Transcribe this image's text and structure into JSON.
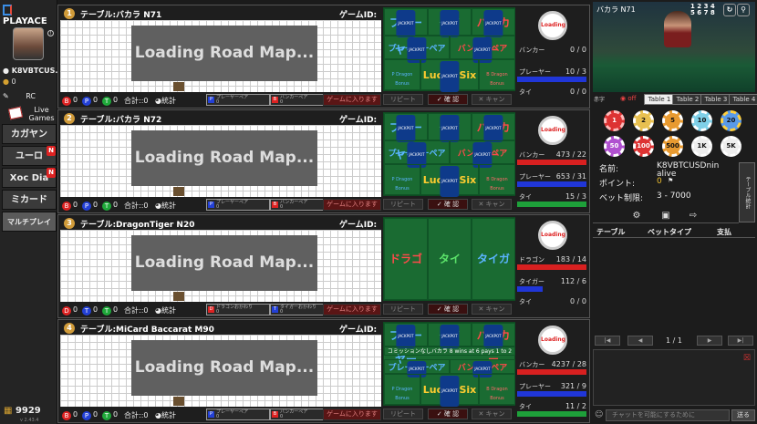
{
  "app": {
    "logo": "PLAYACE",
    "version": "v 2.43.4"
  },
  "user": {
    "name": "K8VBTCUS...",
    "balance": "0",
    "total": "9929"
  },
  "sidebar": {
    "rc": "RC",
    "live_games": "Live Games",
    "items": [
      {
        "label": "カガヤン",
        "badge": ""
      },
      {
        "label": "ユーロ",
        "badge": "N"
      },
      {
        "label": "Xoc Dia",
        "badge": "N"
      },
      {
        "label": "ミカード",
        "badge": ""
      },
      {
        "label": "マルチプレイ",
        "badge": "",
        "active": true
      }
    ]
  },
  "common": {
    "game_id": "ゲームID:",
    "loading": "Loading Road Map...",
    "total": "合計::0",
    "stats": "統計",
    "enter": "ゲームに入ります",
    "repeat": "リピート",
    "confirm": "確 認",
    "cancel": "キャン",
    "loading_btn": "Loading",
    "jackpot": "JACKPOT"
  },
  "tables": [
    {
      "num": "1",
      "name": "テーブル:バカラ N71",
      "type": "baccarat",
      "counters": [
        {
          "k": "B",
          "c": "dr",
          "v": "0"
        },
        {
          "k": "P",
          "c": "db",
          "v": "0"
        },
        {
          "k": "T",
          "c": "dg",
          "v": "0"
        }
      ],
      "mini": [
        {
          "k": "P",
          "c": "db",
          "t": "プレーヤーペア\n0"
        },
        {
          "k": "B",
          "c": "dr",
          "t": "バンカーペア\n0"
        }
      ],
      "bets": {
        "player": "プレーヤー",
        "tie": "タイ",
        "banker": "バンカー",
        "ppair": "プレーヤーペア",
        "bpair": "バンカーペア",
        "p_dragon": "P Dragon Bonus",
        "lucky": "Lucky Six",
        "b_dragon": "B Dragon Bonus"
      },
      "side": [
        {
          "l": "バンカー",
          "v": "0 / 0",
          "bar": "rbar",
          "w": 0
        },
        {
          "l": "プレーヤー",
          "v": "10 / 3",
          "bar": "bbar",
          "w": 76
        },
        {
          "l": "タイ",
          "v": "0 / 0",
          "bar": "gbar",
          "w": 0
        }
      ]
    },
    {
      "num": "2",
      "name": "テーブル:バカラ N72",
      "type": "baccarat",
      "counters": [
        {
          "k": "B",
          "c": "dr",
          "v": "0"
        },
        {
          "k": "P",
          "c": "db",
          "v": "0"
        },
        {
          "k": "T",
          "c": "dg",
          "v": "0"
        }
      ],
      "mini": [
        {
          "k": "P",
          "c": "db",
          "t": "プレーヤーペア\n0"
        },
        {
          "k": "B",
          "c": "dr",
          "t": "バンカーペア\n0"
        }
      ],
      "bets": {
        "player": "プレーヤー",
        "tie": "タイ",
        "banker": "バンカー",
        "ppair": "プレーヤーペア",
        "bpair": "バンカーペア",
        "p_dragon": "P Dragon Bonus",
        "lucky": "Lucky Six",
        "b_dragon": "B Dragon Bonus"
      },
      "side": [
        {
          "l": "バンカー",
          "v": "473 / 22",
          "bar": "rbar",
          "w": 76
        },
        {
          "l": "プレーヤー",
          "v": "653 / 31",
          "bar": "bbar",
          "w": 76
        },
        {
          "l": "タイ",
          "v": "15 / 3",
          "bar": "gbar",
          "w": 76
        }
      ]
    },
    {
      "num": "3",
      "name": "テーブル:DragonTiger N20",
      "type": "dt",
      "counters": [
        {
          "k": "D",
          "c": "dr",
          "v": "0"
        },
        {
          "k": "T",
          "c": "db",
          "v": "0"
        },
        {
          "k": "T",
          "c": "dg",
          "v": "0"
        }
      ],
      "mini": [
        {
          "k": "D",
          "c": "dr",
          "t": "ドラゴンおかわり\n0"
        },
        {
          "k": "T",
          "c": "db",
          "t": "タイガーおかわり\n0"
        }
      ],
      "bets": {
        "dragon": "ドラゴン",
        "tie": "タイ",
        "tiger": "タイガー"
      },
      "side": [
        {
          "l": "ドラゴン",
          "v": "183 / 14",
          "bar": "rbar",
          "w": 76
        },
        {
          "l": "タイガー",
          "v": "112 / 6",
          "bar": "bbar",
          "w": 28
        },
        {
          "l": "タイ",
          "v": "0 / 0",
          "bar": "gbar",
          "w": 0
        }
      ]
    },
    {
      "num": "4",
      "name": "テーブル:MiCard Baccarat M90",
      "type": "baccarat2",
      "counters": [
        {
          "k": "B",
          "c": "dr",
          "v": "0"
        },
        {
          "k": "P",
          "c": "db",
          "v": "0"
        },
        {
          "k": "T",
          "c": "dg",
          "v": "0"
        }
      ],
      "mini": [
        {
          "k": "P",
          "c": "db",
          "t": "プレーヤーペア\n0"
        },
        {
          "k": "B",
          "c": "dr",
          "t": "バンカーペア\n0"
        }
      ],
      "bets": {
        "player": "プレーヤー",
        "tie": "タイ",
        "banker": "バンカー",
        "note": "コミッションなしバカラ 8 wins at 6 pays 1 to 2",
        "ppair": "プレーヤーペア",
        "bpair": "バンカーペア",
        "p_dragon": "P Dragon Bonus",
        "lucky": "Lucky Six",
        "b_dragon": "B Dragon Bonus"
      },
      "side": [
        {
          "l": "バンカー",
          "v": "4237 / 28",
          "bar": "rbar",
          "w": 76
        },
        {
          "l": "プレーヤー",
          "v": "321 / 9",
          "bar": "bbar",
          "w": 76
        },
        {
          "l": "タイ",
          "v": "11 / 2",
          "bar": "gbar",
          "w": 76
        }
      ]
    }
  ],
  "right": {
    "video_title": "バカラ N71",
    "brand": "Playace",
    "video_numbers": "1 2 3 4\n5 6 7 8",
    "muted": "赤字",
    "off": "off",
    "tabs": [
      "Table 1",
      "Table 2",
      "Table 3",
      "Table 4"
    ],
    "chips": [
      "1",
      "2",
      "5",
      "10",
      "20",
      "50",
      "100",
      "500",
      "1K",
      "5K"
    ],
    "info": {
      "name_label": "名前:",
      "name_value": "K8VBTCUSDninalive",
      "points_label": "ポイント:",
      "points_value": "0",
      "limit_label": "ベット制限:",
      "limit_value": "3 - 7000"
    },
    "side_tab": "テーブル統計",
    "history_headers": [
      "テーブル",
      "ベットタイプ",
      "支払"
    ],
    "page": "1 / 1",
    "chat_placeholder": "チャットを可能にするために",
    "send": "送る"
  },
  "colors": {
    "bet_green": "#1a6b32",
    "accent_red": "#d22",
    "accent_blue": "#2340d6"
  }
}
